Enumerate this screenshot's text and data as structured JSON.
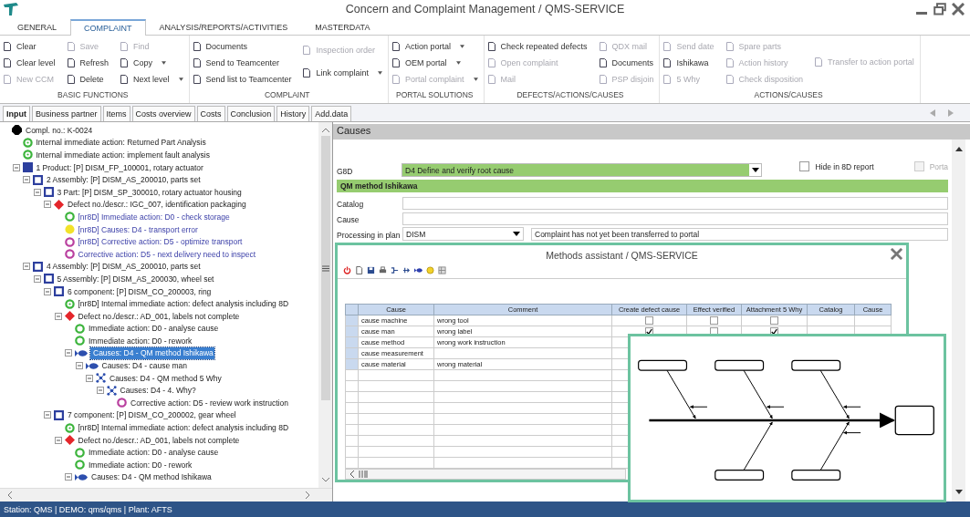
{
  "window": {
    "title": "Concern and Complaint Management / QMS-SERVICE"
  },
  "ribbon": {
    "tabs": [
      {
        "label": "GENERAL",
        "selected": false
      },
      {
        "label": "COMPLAINT",
        "selected": true
      },
      {
        "label": "ANALYSIS/REPORTS/ACTIVITIES",
        "selected": false
      },
      {
        "label": "MASTERDATA",
        "selected": false
      }
    ],
    "groups": [
      {
        "label": "BASIC FUNCTIONS",
        "columns": [
          [
            {
              "label": "Clear",
              "disabled": false,
              "dropdown": false
            },
            {
              "label": "Clear level",
              "disabled": false,
              "dropdown": false
            },
            {
              "label": "New CCM",
              "disabled": true,
              "dropdown": false
            }
          ],
          [
            {
              "label": "Save",
              "disabled": true,
              "dropdown": false
            },
            {
              "label": "Refresh",
              "disabled": false,
              "dropdown": false
            },
            {
              "label": "Delete",
              "disabled": false,
              "dropdown": false
            }
          ],
          [
            {
              "label": "Find",
              "disabled": true,
              "dropdown": false
            },
            {
              "label": "Copy",
              "disabled": false,
              "dropdown": true
            },
            {
              "label": "Next level",
              "disabled": false,
              "dropdown": true
            }
          ]
        ]
      },
      {
        "label": "COMPLAINT",
        "columns": [
          [
            {
              "label": "Documents",
              "disabled": false,
              "dropdown": false
            },
            {
              "label": "Send to Teamcenter",
              "disabled": false,
              "dropdown": false
            },
            {
              "label": "Send list to Teamcenter",
              "disabled": false,
              "dropdown": false
            }
          ],
          [
            {
              "label": "Inspection order",
              "disabled": true,
              "dropdown": false
            },
            {
              "label": "Link complaint",
              "disabled": false,
              "dropdown": true
            }
          ]
        ]
      },
      {
        "label": "PORTAL SOLUTIONS",
        "columns": [
          [
            {
              "label": "Action portal",
              "disabled": false,
              "dropdown": true
            },
            {
              "label": "OEM portal",
              "disabled": false,
              "dropdown": true
            },
            {
              "label": "Portal complaint",
              "disabled": true,
              "dropdown": true
            }
          ]
        ]
      },
      {
        "label": "DEFECTS/ACTIONS/CAUSES",
        "columns": [
          [
            {
              "label": "Check repeated defects",
              "disabled": false,
              "dropdown": false
            },
            {
              "label": "Open complaint",
              "disabled": true,
              "dropdown": false
            },
            {
              "label": "Mail",
              "disabled": true,
              "dropdown": false
            }
          ],
          [
            {
              "label": "QDX mail",
              "disabled": true,
              "dropdown": false
            },
            {
              "label": "Documents",
              "disabled": false,
              "dropdown": false
            },
            {
              "label": "PSP disjoin",
              "disabled": true,
              "dropdown": false
            }
          ]
        ]
      },
      {
        "label": "ACTIONS/CAUSES",
        "columns": [
          [
            {
              "label": "Send date",
              "disabled": true,
              "dropdown": false
            },
            {
              "label": "Ishikawa",
              "disabled": false,
              "dropdown": false
            },
            {
              "label": "5 Why",
              "disabled": true,
              "dropdown": false
            }
          ],
          [
            {
              "label": "Spare parts",
              "disabled": true,
              "dropdown": false
            },
            {
              "label": "Action history",
              "disabled": true,
              "dropdown": false
            },
            {
              "label": "Check disposition",
              "disabled": true,
              "dropdown": false
            }
          ],
          [
            {
              "label": "Transfer to action portal",
              "disabled": true,
              "dropdown": false
            }
          ]
        ]
      }
    ]
  },
  "subtabs": [
    {
      "label": "Input",
      "selected": true
    },
    {
      "label": "Business partner",
      "selected": false
    },
    {
      "label": "Items",
      "selected": false
    },
    {
      "label": "Costs overview",
      "selected": false
    },
    {
      "label": "Costs",
      "selected": false
    },
    {
      "label": "Conclusion",
      "selected": false
    },
    {
      "label": "History",
      "selected": false
    },
    {
      "label": "Add.data",
      "selected": false
    }
  ],
  "tree": {
    "nodes": [
      {
        "label": "Compl. no.: K-0024",
        "kind": "complaint",
        "selected": false,
        "linked": false,
        "children": [
          {
            "label": "Internal immediate action: Returned Part Analysis",
            "kind": "internal_action",
            "selected": false,
            "linked": false
          },
          {
            "label": "Internal immediate action: implement fault analysis",
            "kind": "internal_action",
            "selected": false,
            "linked": false
          },
          {
            "label": "1 Product: [P] DISM_FP_100001, rotary actuator",
            "kind": "product",
            "selected": false,
            "linked": false,
            "expanded": true,
            "children": [
              {
                "label": "2 Assembly: [P] DISM_AS_200010, parts set",
                "kind": "assembly",
                "selected": false,
                "linked": false,
                "expanded": true,
                "children": [
                  {
                    "label": "3 Part: [P] DISM_SP_300010, rotary actuator housing",
                    "kind": "assembly",
                    "selected": false,
                    "linked": false,
                    "expanded": true,
                    "children": [
                      {
                        "label": "Defect no./descr.: IGC_007, identification packaging",
                        "kind": "defect",
                        "selected": false,
                        "linked": false,
                        "expanded": true,
                        "children": [
                          {
                            "label": "[nr8D] Immediate action: D0 - check storage",
                            "kind": "immediate_action",
                            "selected": false,
                            "linked": true
                          },
                          {
                            "label": "[nr8D] Causes: D4 - transport error",
                            "kind": "cause",
                            "selected": false,
                            "linked": true
                          },
                          {
                            "label": "[nr8D] Corrective action: D5 - optimize transport",
                            "kind": "corrective_action",
                            "selected": false,
                            "linked": true
                          },
                          {
                            "label": "Corrective action: D5 - next delivery need to inspect",
                            "kind": "corrective_action",
                            "selected": false,
                            "linked": true
                          }
                        ]
                      }
                    ]
                  }
                ]
              },
              {
                "label": "4 Assembly: [P] DISM_AS_200010, parts set",
                "kind": "assembly",
                "selected": false,
                "linked": false,
                "expanded": true,
                "children": [
                  {
                    "label": "5 Assembly: [P] DISM_AS_200030, wheel set",
                    "kind": "assembly",
                    "selected": false,
                    "linked": false,
                    "expanded": true,
                    "children": [
                      {
                        "label": "6 component: [P] DISM_CO_200003, ring",
                        "kind": "assembly",
                        "selected": false,
                        "linked": false,
                        "expanded": true,
                        "children": [
                          {
                            "label": "[nr8D] Internal immediate action: defect analysis including 8D",
                            "kind": "internal_action",
                            "selected": false,
                            "linked": false
                          },
                          {
                            "label": "Defect no./descr.: AD_001, labels not complete",
                            "kind": "defect",
                            "selected": false,
                            "linked": false,
                            "expanded": true,
                            "children": [
                              {
                                "label": "Immediate action: D0 - analyse cause",
                                "kind": "immediate_action",
                                "selected": false,
                                "linked": false
                              },
                              {
                                "label": "Immediate action: D0 - rework",
                                "kind": "immediate_action",
                                "selected": false,
                                "linked": false
                              },
                              {
                                "label": "Causes: D4 - QM method Ishikawa",
                                "kind": "ishikawa",
                                "selected": true,
                                "linked": false,
                                "expanded": true,
                                "children": [
                                  {
                                    "label": "Causes: D4 - cause man",
                                    "kind": "ishikawa",
                                    "selected": false,
                                    "linked": false,
                                    "expanded": true,
                                    "children": [
                                      {
                                        "label": "Causes: D4 - QM method 5 Why",
                                        "kind": "five_why",
                                        "selected": false,
                                        "linked": false,
                                        "expanded": true,
                                        "children": [
                                          {
                                            "label": "Causes: D4 - 4. Why?",
                                            "kind": "five_why",
                                            "selected": false,
                                            "linked": false,
                                            "expanded": true,
                                            "children": [
                                              {
                                                "label": "Corrective action: D5 - review work instruction",
                                                "kind": "corrective_action",
                                                "selected": false,
                                                "linked": false
                                              }
                                            ]
                                          }
                                        ]
                                      }
                                    ]
                                  }
                                ]
                              }
                            ]
                          }
                        ]
                      },
                      {
                        "label": "7 component: [P] DISM_CO_200002, gear wheel",
                        "kind": "assembly",
                        "selected": false,
                        "linked": false,
                        "expanded": true,
                        "children": [
                          {
                            "label": "[nr8D] Internal immediate action: defect analysis including 8D",
                            "kind": "internal_action",
                            "selected": false,
                            "linked": false
                          },
                          {
                            "label": "Defect no./descr.: AD_001, labels not complete",
                            "kind": "defect",
                            "selected": false,
                            "linked": false,
                            "expanded": true,
                            "children": [
                              {
                                "label": "Immediate action: D0 - analyse cause",
                                "kind": "immediate_action",
                                "selected": false,
                                "linked": false
                              },
                              {
                                "label": "Immediate action: D0 - rework",
                                "kind": "immediate_action",
                                "selected": false,
                                "linked": false
                              },
                              {
                                "label": "Causes: D4 - QM method Ishikawa",
                                "kind": "ishikawa",
                                "selected": false,
                                "linked": false,
                                "expanded": true
                              }
                            ]
                          }
                        ]
                      }
                    ]
                  }
                ]
              }
            ]
          }
        ]
      }
    ]
  },
  "detail": {
    "title": "Causes",
    "g8d": {
      "label": "G8D",
      "value": "D4 Define and verify root cause"
    },
    "checkboxes": [
      {
        "label": "Hide in 8D report",
        "checked": false,
        "disabled": false
      },
      {
        "label": "Porta",
        "checked": false,
        "disabled": true
      }
    ],
    "section": "QM method Ishikawa",
    "catalog": {
      "label": "Catalog"
    },
    "cause": {
      "label": "Cause"
    },
    "processing": {
      "label": "Processing in plan",
      "value": "DISM",
      "status": "Complaint has not yet been transferred to portal"
    }
  },
  "methods_assistant": {
    "title": "Methods assistant / QMS-SERVICE",
    "columns": [
      "Cause",
      "Comment",
      "Create defect cause",
      "Effect verified",
      "Attachment 5 Why",
      "Catalog",
      "Cause"
    ],
    "rows": [
      {
        "cause": "cause machine",
        "comment": "wrong tool",
        "create_defect_cause": false,
        "effect_verified": false,
        "attachment_5_why": false
      },
      {
        "cause": "cause man",
        "comment": "wrong label",
        "create_defect_cause": true,
        "effect_verified": false,
        "attachment_5_why": true
      },
      {
        "cause": "cause method",
        "comment": "wrong work instruction"
      },
      {
        "cause": "cause measurement"
      },
      {
        "cause": "cause material",
        "comment": "wrong material"
      }
    ]
  },
  "status_bar": "Station: QMS | DEMO: qms/qms | Plant: AFTS"
}
